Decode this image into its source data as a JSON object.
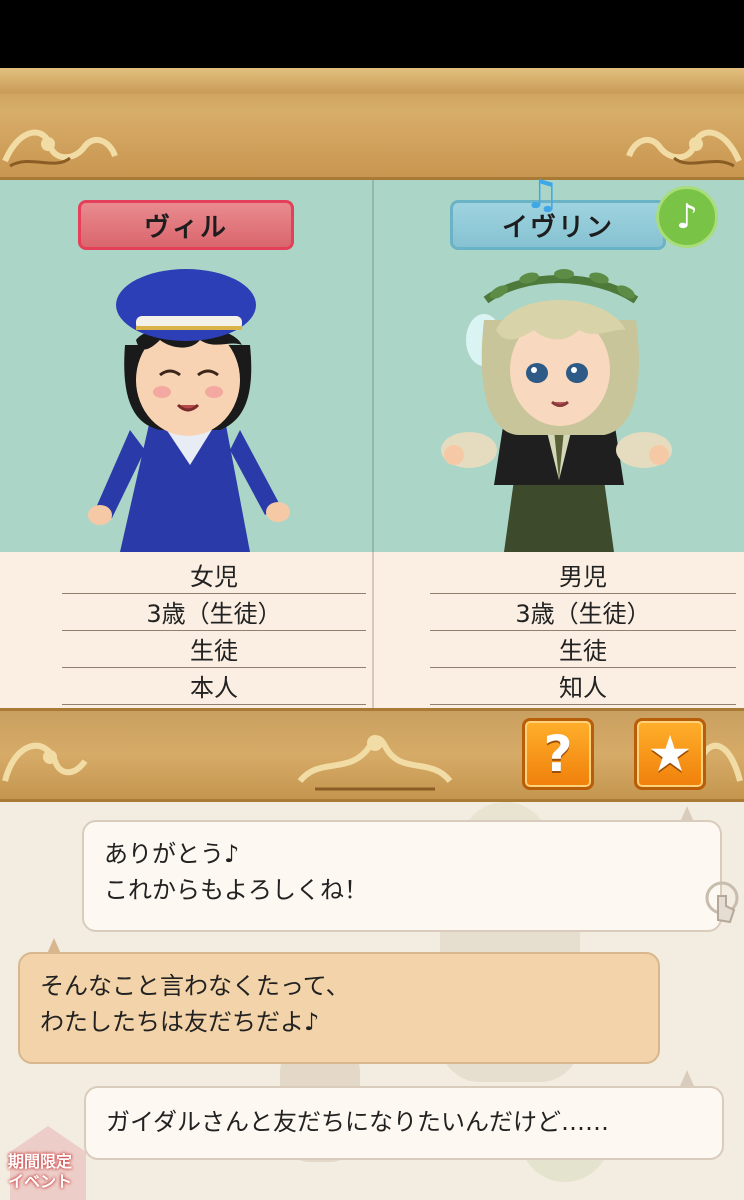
{
  "characters": {
    "left": {
      "name": "ヴィル",
      "tag_color": "#d9666d",
      "info": [
        "女児",
        "3歳（生徒）",
        "生徒",
        "本人"
      ]
    },
    "right": {
      "name": "イヴリン",
      "tag_color": "#86c2d2",
      "info": [
        "男児",
        "3歳（生徒）",
        "生徒",
        "知人"
      ]
    }
  },
  "buttons": {
    "music_icon": "♪",
    "help_icon": "?",
    "favorite_icon": "★"
  },
  "chat": {
    "messages": [
      {
        "side": "right",
        "style": "white",
        "lines": [
          "ありがとう♪",
          "これからもよろしくね！"
        ]
      },
      {
        "side": "left",
        "style": "tan",
        "lines": [
          "そんなこと言わなくたって、",
          "わたしたちは友だちだよ♪"
        ]
      },
      {
        "side": "right",
        "style": "white",
        "lines": [
          "ガイダルさんと友だちになりたいんだけど……"
        ]
      }
    ]
  },
  "event_badge": [
    "期間限定",
    "イベント"
  ]
}
